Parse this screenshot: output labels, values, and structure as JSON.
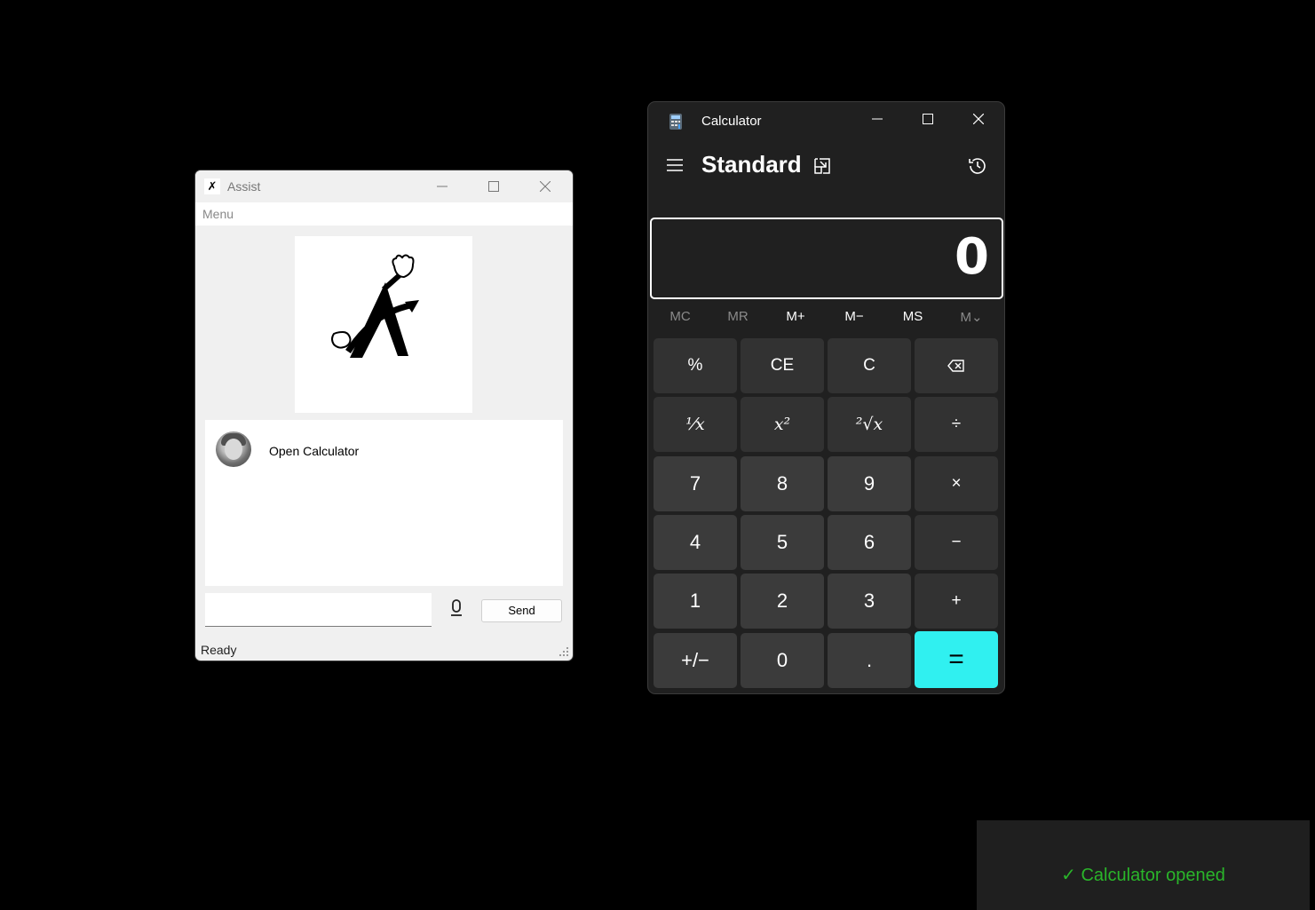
{
  "assist": {
    "title": "Assist",
    "menu": "Menu",
    "chat": {
      "message": "Open Calculator"
    },
    "input_value": "",
    "send_label": "Send",
    "status": "Ready"
  },
  "calculator": {
    "title": "Calculator",
    "mode": "Standard",
    "display": "0",
    "memory": [
      "MC",
      "MR",
      "M+",
      "M−",
      "MS",
      "M⌄"
    ],
    "keys": [
      [
        "%",
        "CE",
        "C",
        "⌫"
      ],
      [
        "¹⁄x",
        "x²",
        "²√x",
        "÷"
      ],
      [
        "7",
        "8",
        "9",
        "×"
      ],
      [
        "4",
        "5",
        "6",
        "−"
      ],
      [
        "1",
        "2",
        "3",
        "+"
      ],
      [
        "+/−",
        "0",
        ".",
        "="
      ]
    ],
    "accent_color": "#30f0f0"
  },
  "toast": {
    "text": "✓ Calculator opened",
    "color": "#2ab52a"
  },
  "icons": {
    "assist_app": "assist-logo-icon",
    "calculator_app": "calculator-app-icon",
    "menu": "hamburger-icon",
    "keep_on_top": "keep-on-top-icon",
    "history": "history-icon",
    "backspace": "backspace-icon",
    "mic": "microphone-icon"
  }
}
